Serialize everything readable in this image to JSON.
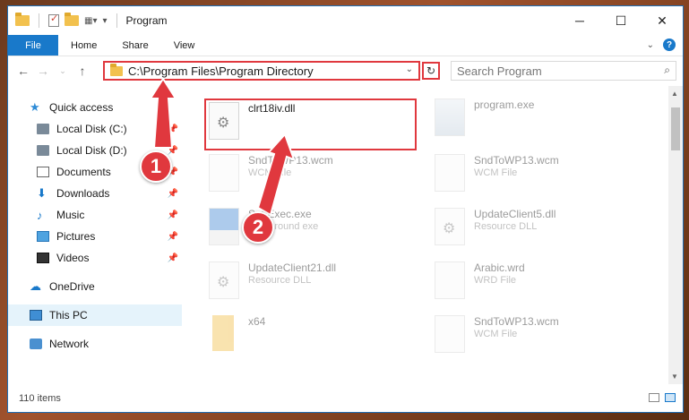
{
  "window": {
    "title": "Program"
  },
  "controls": {
    "minimize": "─",
    "maximize": "☐",
    "close": "✕"
  },
  "ribbon": {
    "tabs": [
      "File",
      "Home",
      "Share",
      "View"
    ]
  },
  "address": {
    "path": "C:\\Program Files\\Program Directory"
  },
  "search": {
    "placeholder": "Search Program"
  },
  "sidebar": {
    "items": [
      {
        "label": "Quick access",
        "icon": "star-icon",
        "pinned": false
      },
      {
        "label": "Local Disk (C:)",
        "icon": "drive-icon",
        "pinned": true
      },
      {
        "label": "Local Disk (D:)",
        "icon": "drive-icon",
        "pinned": true
      },
      {
        "label": "Documents",
        "icon": "document-icon",
        "pinned": true
      },
      {
        "label": "Downloads",
        "icon": "download-icon",
        "pinned": true
      },
      {
        "label": "Music",
        "icon": "music-icon",
        "pinned": true
      },
      {
        "label": "Pictures",
        "icon": "pictures-icon",
        "pinned": true
      },
      {
        "label": "Videos",
        "icon": "videos-icon",
        "pinned": true
      },
      {
        "label": "OneDrive",
        "icon": "cloud-icon"
      },
      {
        "label": "This PC",
        "icon": "pc-icon",
        "selected": true
      },
      {
        "label": "Network",
        "icon": "network-icon"
      }
    ]
  },
  "files": [
    {
      "name": "clrt18iv.dll",
      "type": "",
      "highlighted": true
    },
    {
      "name": "program.exe",
      "type": ""
    },
    {
      "name": "SndToWP13.wcm",
      "type": "WCM File"
    },
    {
      "name": "SndToWP13.wcm",
      "type": "WCM File"
    },
    {
      "name": "SubExec.exe",
      "type": "background exe"
    },
    {
      "name": "UpdateClient5.dll",
      "type": "Resource DLL"
    },
    {
      "name": "UpdateClient21.dll",
      "type": "Resource DLL"
    },
    {
      "name": "Arabic.wrd",
      "type": "WRD File"
    },
    {
      "name": "x64",
      "type": ""
    },
    {
      "name": "SndToWP13.wcm",
      "type": "WCM File"
    }
  ],
  "status": {
    "items": "110 items"
  },
  "annotations": {
    "step1": "1",
    "step2": "2"
  },
  "colors": {
    "accent": "#1979ca",
    "highlight": "#e0383e"
  }
}
